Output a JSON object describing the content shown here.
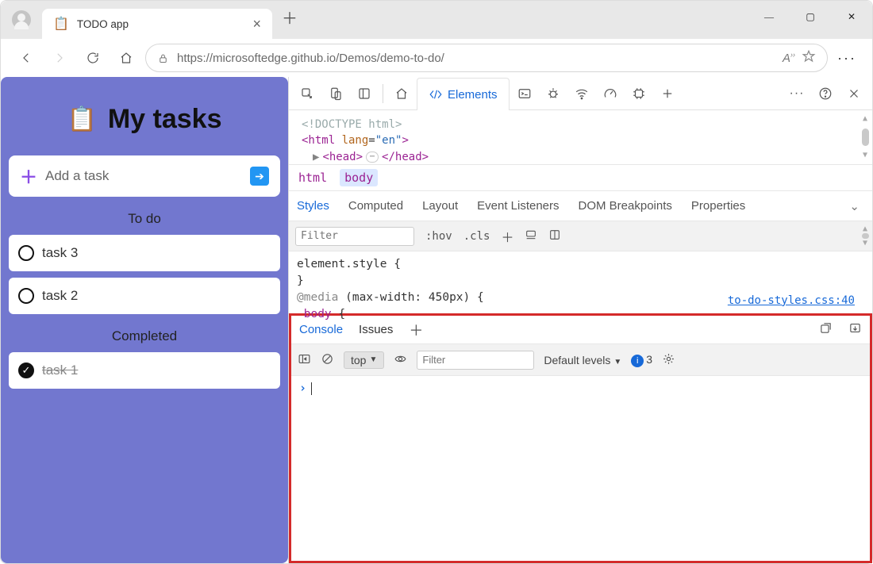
{
  "browser": {
    "tab_title": "TODO app",
    "url": "https://microsoftedge.github.io/Demos/demo-to-do/"
  },
  "app": {
    "title": "My tasks",
    "add_placeholder": "Add a task",
    "section_todo": "To do",
    "section_done": "Completed",
    "tasks_todo": [
      "task 3",
      "task 2"
    ],
    "tasks_done": [
      "task 1"
    ]
  },
  "devtools": {
    "main_tabs": {
      "elements": "Elements"
    },
    "dom": {
      "doctype": "<!DOCTYPE html>",
      "html_open": "<html lang=\"en\">",
      "head": "<head> … </head>"
    },
    "breadcrumbs": [
      "html",
      "body"
    ],
    "style_tabs": [
      "Styles",
      "Computed",
      "Layout",
      "Event Listeners",
      "DOM Breakpoints",
      "Properties"
    ],
    "style_filter_placeholder": "Filter",
    "style_hov": ":hov",
    "style_cls": ".cls",
    "style_body": {
      "l1": "element.style {",
      "l2": "}",
      "l3": "@media (max-width: 450px) {",
      "l4": " body {",
      "src": "to-do-styles.css:40"
    },
    "drawer_tabs": [
      "Console",
      "Issues"
    ],
    "console": {
      "context": "top",
      "filter_placeholder": "Filter",
      "levels": "Default levels",
      "issue_count": "3"
    }
  }
}
